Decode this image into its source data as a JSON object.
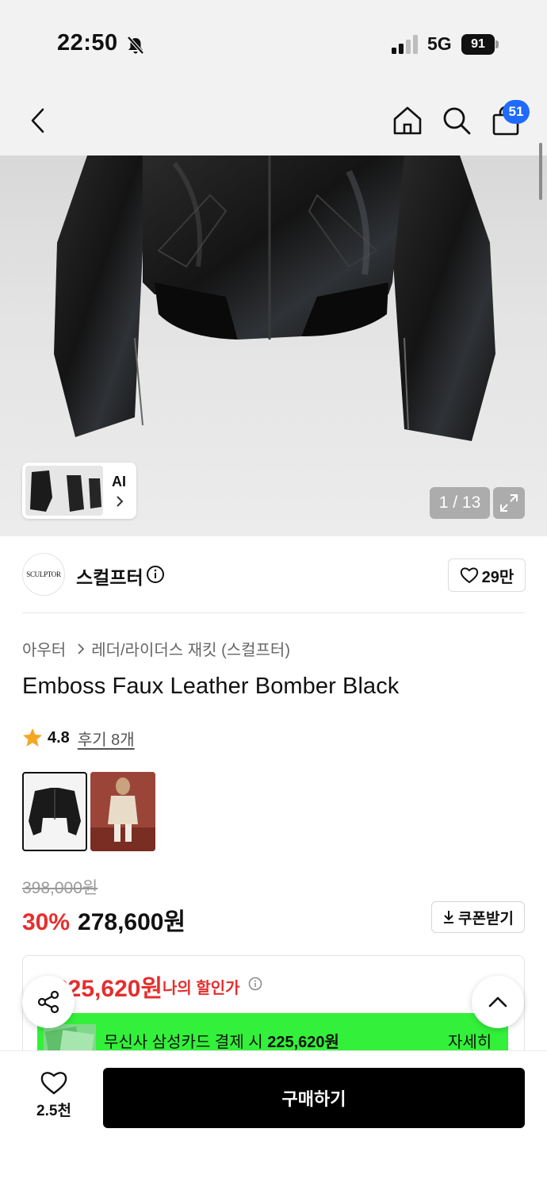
{
  "status_bar": {
    "time": "22:50",
    "network": "5G",
    "battery": "91"
  },
  "nav": {
    "cart_count": "51"
  },
  "gallery": {
    "ai_label": "AI",
    "page_indicator": "1 / 13"
  },
  "brand": {
    "logo_text": "SCULPTOR",
    "name": "스컬프터",
    "like_count": "29만"
  },
  "breadcrumb": {
    "category": "아우터",
    "subcategory": "레더/라이더스 재킷 (스컬프터)"
  },
  "product": {
    "title": "Emboss Faux Leather Bomber Black",
    "rating": "4.8",
    "review_link": "후기 8개",
    "original_price": "398,000원",
    "discount_rate": "30%",
    "sale_price": "278,600원",
    "coupon_label": "쿠폰받기"
  },
  "my_price": {
    "value": "225,620원",
    "label": "나의 할인가",
    "card_text_prefix": "무신사 삼성카드 결제 시 ",
    "card_text_price": "225,620원",
    "card_detail": "자세히"
  },
  "bottom_bar": {
    "wish_count": "2.5천",
    "buy_label": "구매하기"
  },
  "colors": {
    "accent_red": "#e62e2e",
    "badge_blue": "#1f6bff",
    "banner_green": "#33f03a"
  }
}
